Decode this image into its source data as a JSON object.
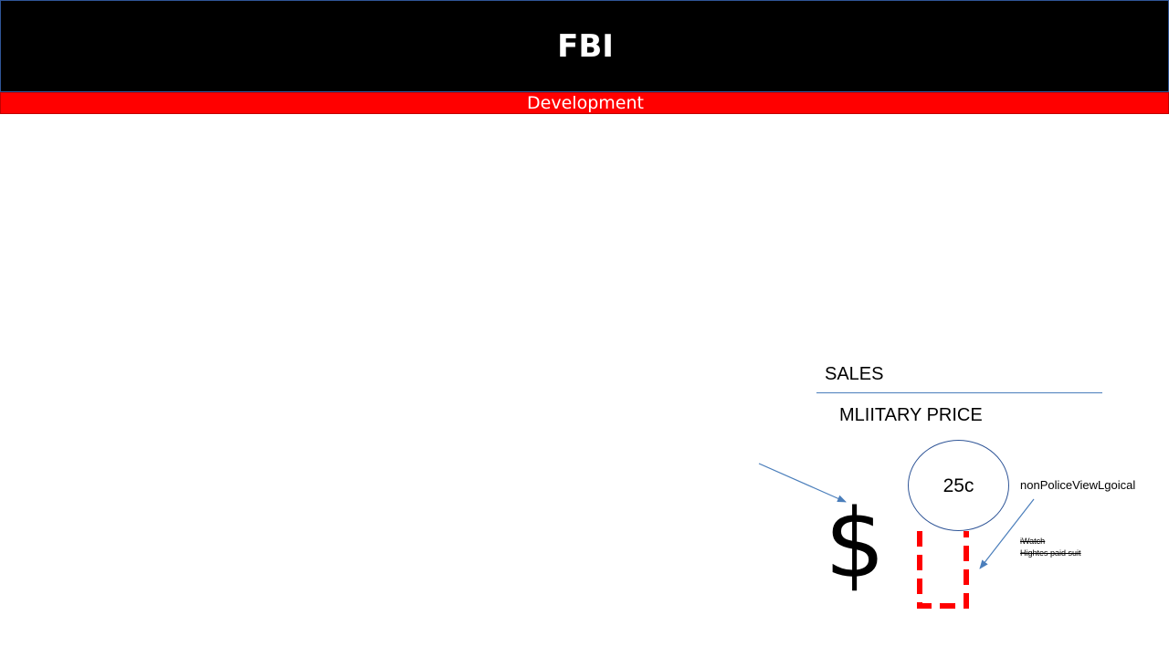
{
  "header": {
    "title": "FBI",
    "subtitle": "Development"
  },
  "content": {
    "sales_label": "SALES",
    "military_label": "MLIITARY PRICE",
    "price_value": "25c",
    "currency_symbol": "$",
    "side_note": "nonPoliceViewLgoical",
    "struck_items": [
      "iWatch",
      "Hightes paid suit"
    ]
  },
  "colors": {
    "title_bar": "#000000",
    "subtitle_bar": "#ff0000",
    "accent_line": "#4a7ebb",
    "dashed_shape": "#ff0000"
  }
}
